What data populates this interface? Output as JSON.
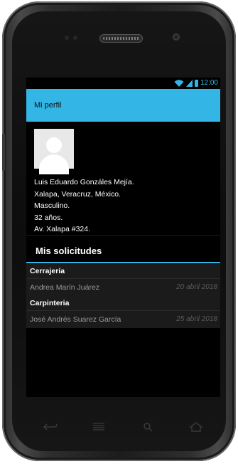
{
  "status_bar": {
    "time": "12:00",
    "icons": [
      "wifi-icon",
      "signal-icon",
      "battery-icon"
    ],
    "accent_color": "#33b5e5"
  },
  "action_bar": {
    "title": "Mi perfil",
    "color": "#33b5e5"
  },
  "profile": {
    "avatar_icon": "user-avatar-placeholder-icon",
    "lines": [
      "Luis Eduardo Gonzáles Mejía.",
      "Xalapa, Veracruz, México.",
      "Masculino.",
      "32 años.",
      "Av. Xalapa #324."
    ]
  },
  "requests": {
    "title": "Mis solicitudes",
    "items": [
      {
        "category": "Cerrajería",
        "person": "Andrea Marín Juárez",
        "date": "20 abril 2018"
      },
      {
        "category": "Carpinteria",
        "person": "José Andrés Suarez García",
        "date": "25 abril 2018"
      }
    ]
  },
  "device_nav": {
    "buttons": [
      "back-icon",
      "menu-icon",
      "search-icon",
      "home-icon"
    ]
  }
}
